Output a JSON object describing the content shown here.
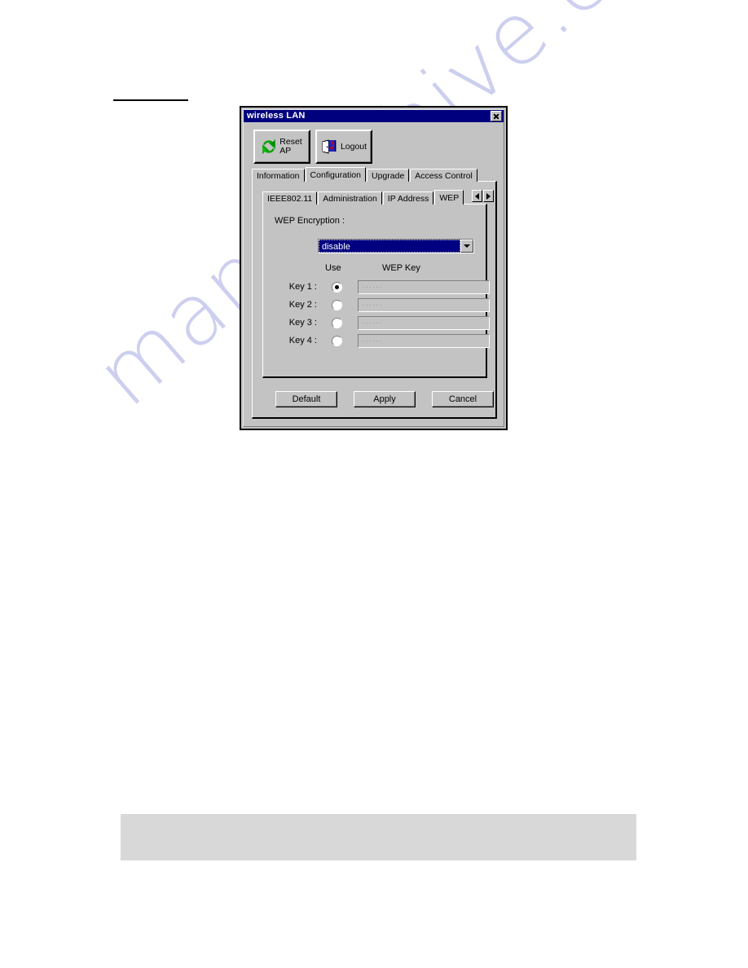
{
  "page": {
    "rule_present": true,
    "watermark_text": "manualshive.com"
  },
  "dialog": {
    "title": "wireless LAN",
    "close_label": "✕",
    "toolbar": {
      "buttons": [
        {
          "label": "Reset\nAP",
          "icon": "refresh-icon"
        },
        {
          "label": "Logout",
          "icon": "logout-door-icon"
        }
      ]
    },
    "outer_tabs": [
      {
        "label": "Information",
        "active": false
      },
      {
        "label": "Configuration",
        "active": true
      },
      {
        "label": "Upgrade",
        "active": false
      },
      {
        "label": "Access Control",
        "active": false
      }
    ],
    "inner_tabs": [
      {
        "label": "IEEE802.11",
        "active": false
      },
      {
        "label": "Administration",
        "active": false
      },
      {
        "label": "IP Address",
        "active": false
      },
      {
        "label": "WEP",
        "active": true
      }
    ],
    "tab_scroll": {
      "left": "◄",
      "right": "►"
    },
    "wep": {
      "encryption_label": "WEP Encryption :",
      "encryption_value": "disable",
      "column_use": "Use",
      "column_key": "WEP Key",
      "keys": [
        {
          "label": "Key 1 :",
          "selected": true,
          "value": "······"
        },
        {
          "label": "Key 2 :",
          "selected": false,
          "value": "······"
        },
        {
          "label": "Key 3 :",
          "selected": false,
          "value": "······"
        },
        {
          "label": "Key 4 :",
          "selected": false,
          "value": "······"
        }
      ]
    },
    "buttons": [
      {
        "label": "Default"
      },
      {
        "label": "Apply"
      },
      {
        "label": "Cancel"
      }
    ]
  },
  "colors": {
    "titlebar": "#00007e",
    "face": "#c3c3c3",
    "highlight": "#000080",
    "watermark": "#c9cbee",
    "bottom_panel": "#d8d8d8"
  }
}
